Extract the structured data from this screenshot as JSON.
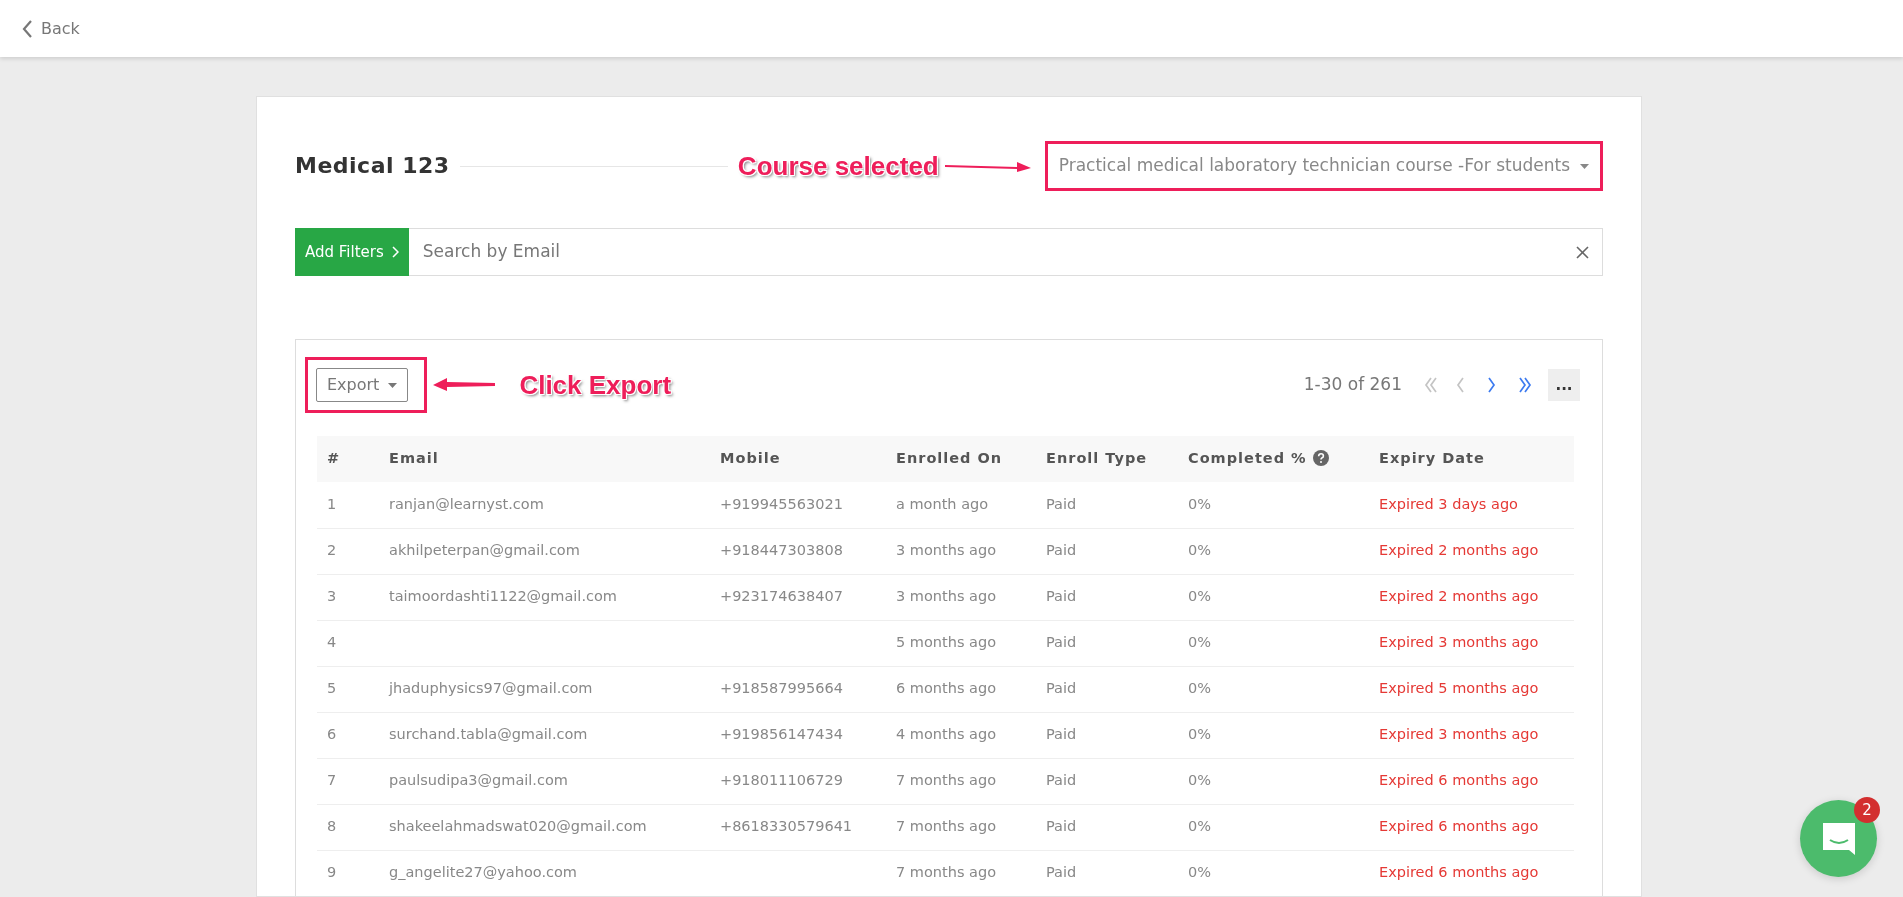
{
  "header": {
    "back_label": "Back"
  },
  "course": {
    "title": "Medical 123",
    "annotation": "Course selected",
    "selected_course": "Practical medical laboratory technician course -For students"
  },
  "filters": {
    "button": "Add Filters",
    "placeholder": "Search by Email"
  },
  "toolbar": {
    "export": "Export",
    "annotation": "Click Export",
    "range": "1-30 of 261",
    "more": "...",
    "pager": [
      {
        "kind": "first",
        "disabled": true
      },
      {
        "kind": "prev",
        "disabled": true
      },
      {
        "kind": "next",
        "disabled": false
      },
      {
        "kind": "last",
        "disabled": false
      }
    ]
  },
  "table": {
    "columns": [
      "#",
      "Email",
      "Mobile",
      "Enrolled On",
      "Enroll Type",
      "Completed %",
      "Expiry Date"
    ],
    "rows": [
      {
        "num": "1",
        "email": "ranjan@learnyst.com",
        "mobile": "+919945563021",
        "enrolled_on": "a month ago",
        "enroll_type": "Paid",
        "completed": "0%",
        "expiry": "Expired 3 days ago"
      },
      {
        "num": "2",
        "email": "akhilpeterpan@gmail.com",
        "mobile": "+918447303808",
        "enrolled_on": "3 months ago",
        "enroll_type": "Paid",
        "completed": "0%",
        "expiry": "Expired 2 months ago"
      },
      {
        "num": "3",
        "email": "taimoordashti1122@gmail.com",
        "mobile": "+923174638407",
        "enrolled_on": "3 months ago",
        "enroll_type": "Paid",
        "completed": "0%",
        "expiry": "Expired 2 months ago"
      },
      {
        "num": "4",
        "enrolled_on": "5 months ago",
        "enroll_type": "Paid",
        "completed": "0%",
        "expiry": "Expired 3 months ago"
      },
      {
        "num": "5",
        "email": "jhaduphysics97@gmail.com",
        "mobile": "+918587995664",
        "enrolled_on": "6 months ago",
        "enroll_type": "Paid",
        "completed": "0%",
        "expiry": "Expired 5 months ago"
      },
      {
        "num": "6",
        "email": "surchand.tabla@gmail.com",
        "mobile": "+919856147434",
        "enrolled_on": "4 months ago",
        "enroll_type": "Paid",
        "completed": "0%",
        "expiry": "Expired 3 months ago"
      },
      {
        "num": "7",
        "email": "paulsudipa3@gmail.com",
        "mobile": "+918011106729",
        "enrolled_on": "7 months ago",
        "enroll_type": "Paid",
        "completed": "0%",
        "expiry": "Expired 6 months ago"
      },
      {
        "num": "8",
        "email": "shakeelahmadswat020@gmail.com",
        "mobile": "+8618330579641",
        "enrolled_on": "7 months ago",
        "enroll_type": "Paid",
        "completed": "0%",
        "expiry": "Expired 6 months ago"
      },
      {
        "num": "9",
        "email": "g_angelite27@yahoo.com",
        "enrolled_on": "7 months ago",
        "enroll_type": "Paid",
        "completed": "0%",
        "expiry": "Expired 6 months ago"
      }
    ]
  },
  "chat": {
    "badge": "2"
  }
}
